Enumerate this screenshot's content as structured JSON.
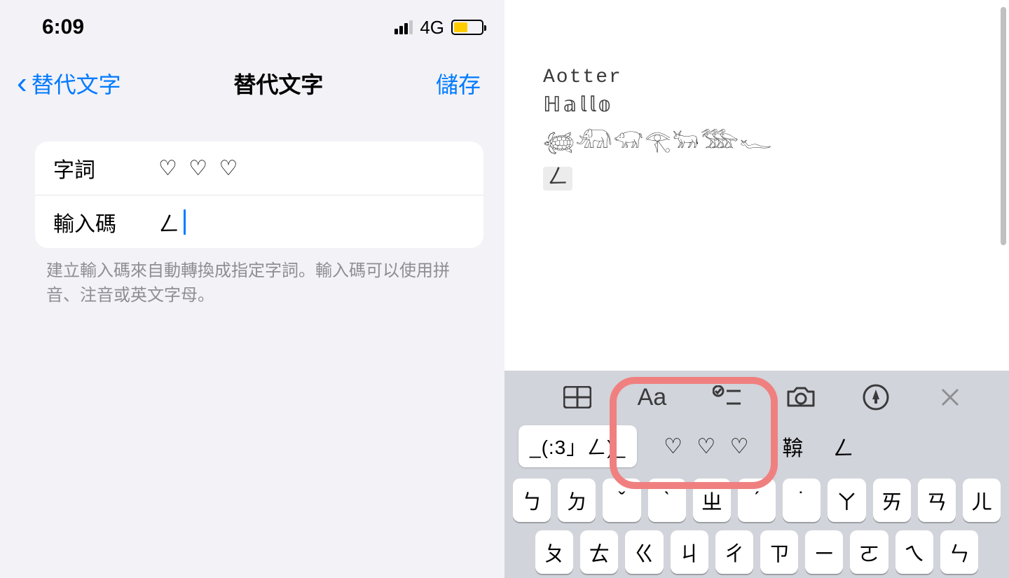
{
  "left": {
    "status": {
      "time": "6:09",
      "network": "4G"
    },
    "nav": {
      "back": "替代文字",
      "title": "替代文字",
      "save": "儲存"
    },
    "rows": {
      "phrase_label": "字詞",
      "phrase_value": "♡ ♡ ♡",
      "code_label": "輸入碼",
      "code_value": "ㄥ"
    },
    "hint": "建立輸入碼來自動轉換成指定字詞。輸入碼可以使用拼音、注音或英文字母。"
  },
  "right": {
    "note": {
      "l1": "Aotter",
      "l2": "ℍ𝕒𝕝𝕝𝕠",
      "l3": "𓆉𓃰𓃟𓂀𓃒𓅢𓆑",
      "l4": "ㄥ"
    },
    "candidates": {
      "c0": "_(:3」ㄥ)_",
      "c1": "♡ ♡ ♡",
      "c2": "鞥",
      "c3": "ㄥ"
    },
    "keys_row1": [
      "ㄅ",
      "ㄉ",
      "ˇ",
      "ˋ",
      "ㄓ",
      "ˊ",
      "˙",
      "ㄚ",
      "ㄞ",
      "ㄢ",
      "ㄦ"
    ],
    "keys_row2": [
      "ㄆ",
      "ㄊ",
      "ㄍ",
      "ㄐ",
      "ㄔ",
      "ㄗ",
      "ㄧ",
      "ㄛ",
      "ㄟ",
      "ㄣ"
    ]
  }
}
